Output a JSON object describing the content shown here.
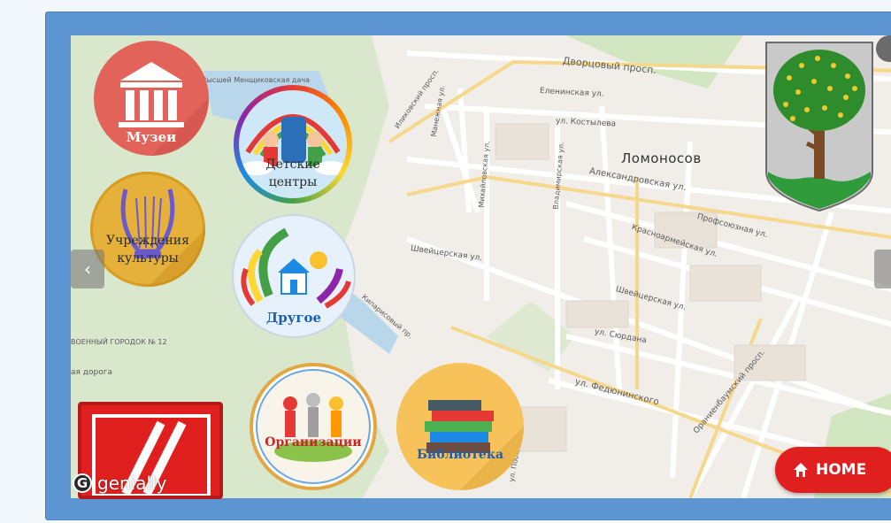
{
  "map": {
    "city_label": "Ломоносов",
    "streets": [
      {
        "text": "Дворцовый просп."
      },
      {
        "text": "Еленинская ул."
      },
      {
        "text": "ул. Костылева"
      },
      {
        "text": "Александровская ул."
      },
      {
        "text": "Профсоюзная ул."
      },
      {
        "text": "Красноармейская ул."
      },
      {
        "text": "Швейцерская ул."
      },
      {
        "text": "Швейцерская ул."
      },
      {
        "text": "ул. Сюрдана"
      },
      {
        "text": "ул. Федюнинского"
      },
      {
        "text": "Ораниенбаумский просп."
      },
      {
        "text": "Манежная ул."
      },
      {
        "text": "Михайловская ул."
      },
      {
        "text": "Иликовский просп."
      },
      {
        "text": "Владимирская ул."
      },
      {
        "text": "Кипарисовый пр."
      },
      {
        "text": "ВОЕННЫЙ ГОРОДОК № 12"
      },
      {
        "text": "ая дорога"
      },
      {
        "text": "ул. Победы"
      },
      {
        "text": "Высшей Менщиковская дача"
      }
    ]
  },
  "buttons": {
    "museum": "Музеи",
    "children_centers": "Детские центры",
    "culture": "Учреждения культуры",
    "other": "Другое",
    "organizations": "Организации",
    "library": "Библиотека"
  },
  "home_label": "HOME",
  "brand_label": "genially",
  "colors": {
    "frame": "#5d95d2",
    "museum_circle": "#e2635a",
    "culture_circle": "#e6b13a",
    "library_circle": "#f6c259",
    "home_button": "#e0201f"
  }
}
